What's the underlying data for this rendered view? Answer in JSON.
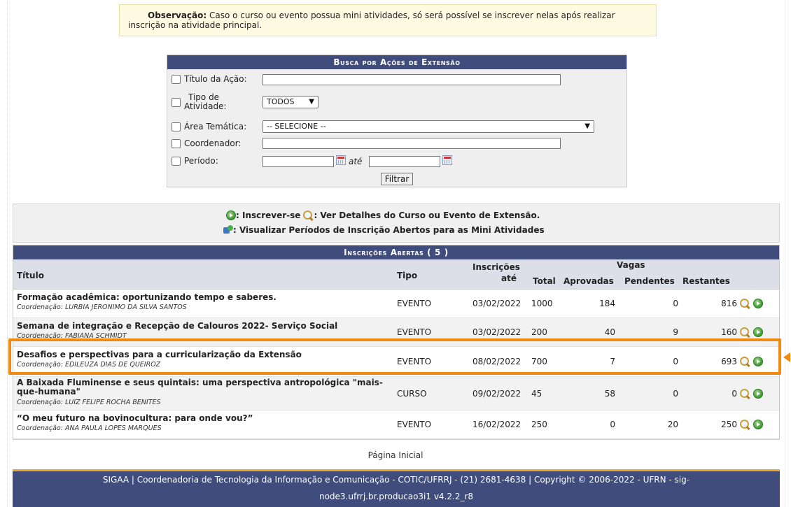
{
  "note": {
    "label": "Observação:",
    "text_line1": "Caso o curso ou evento possua mini atividades, só será possível se inscrever nelas após realizar",
    "text_line2": "inscrição na atividade principal."
  },
  "search": {
    "title": "Busca por Ações de Extensão",
    "fields": {
      "titulo": "Título da Ação:",
      "tipo_line1": "Tipo de",
      "tipo_line2": "Atividade:",
      "area": "Área Temática:",
      "coordenador": "Coordenador:",
      "periodo": "Período:"
    },
    "tipo_value": "TODOS",
    "area_value": "-- SELECIONE --",
    "ate": "até",
    "button": "Filtrar"
  },
  "legend": {
    "inscrever": ": Inscrever-se",
    "detalhes": ": Ver Detalhes do Curso ou Evento de Extensão.",
    "periodos": ": Visualizar Períodos de Inscrição Abertos para as Mini Atividades"
  },
  "results": {
    "title": "Inscrições Abertas ( 5 )",
    "headers": {
      "titulo": "Título",
      "tipo": "Tipo",
      "inscricoes_line1": "Inscrições",
      "inscricoes_line2": "até",
      "vagas": "Vagas",
      "total": "Total",
      "aprovadas": "Aprovadas",
      "pendentes": "Pendentes",
      "restantes": "Restantes"
    },
    "rows": [
      {
        "titulo": "Formação acadêmica: oportunizando tempo e saberes.",
        "coord": "Coordenação: LURBIA JERONIMO DA SILVA SANTOS",
        "tipo": "EVENTO",
        "ate": "03/02/2022",
        "total": "1000",
        "aprovadas": "184",
        "pendentes": "0",
        "restantes": "816"
      },
      {
        "titulo": "Semana de integração e Recepção de Calouros 2022- Serviço Social",
        "coord": "Coordenação: FABIANA SCHMIDT",
        "tipo": "EVENTO",
        "ate": "03/02/2022",
        "total": "200",
        "aprovadas": "40",
        "pendentes": "9",
        "restantes": "160"
      },
      {
        "titulo": "Desafios e perspectivas para a curricularização da Extensão",
        "coord": "Coordenação: EDILEUZA DIAS DE QUEIROZ",
        "tipo": "EVENTO",
        "ate": "08/02/2022",
        "total": "700",
        "aprovadas": "7",
        "pendentes": "0",
        "restantes": "693"
      },
      {
        "titulo": "A Baixada Fluminense e seus quintais: uma perspectiva antropológica \"mais-que-humana\"",
        "coord": "Coordenação: LUIZ FELIPE ROCHA BENITES",
        "tipo": "CURSO",
        "ate": "09/02/2022",
        "total": "45",
        "aprovadas": "58",
        "pendentes": "0",
        "restantes": "0"
      },
      {
        "titulo": "“O meu futuro na bovinocultura: para onde vou?”",
        "coord": "Coordenação: ANA PAULA LOPES MARQUES",
        "tipo": "EVENTO",
        "ate": "16/02/2022",
        "total": "250",
        "aprovadas": "0",
        "pendentes": "20",
        "restantes": "250"
      }
    ]
  },
  "home_link": "Página Inicial",
  "footer": {
    "line1": "SIGAA | Coordenadoria de Tecnologia da Informação e Comunicação - COTIC/UFRRJ - (21) 2681-4638 | Copyright © 2006-2022 - UFRN - sig-",
    "line2": "node3.ufrrj.br.producao3i1 v4.2.2_r8"
  },
  "colors": {
    "header_bg": "#3f4c7c",
    "highlight": "#f08a12",
    "note_bg": "#fffbe3"
  }
}
